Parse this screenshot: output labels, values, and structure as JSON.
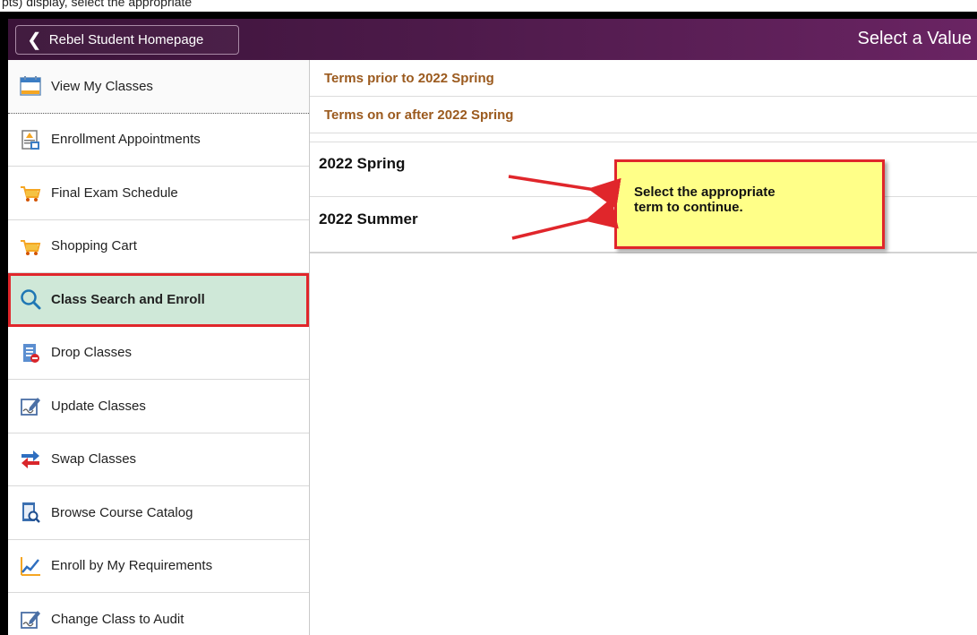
{
  "banner": {
    "text": "pts) display, select the appropriate"
  },
  "header": {
    "back_label": "Rebel Student Homepage",
    "title": "Select a Value"
  },
  "sidebar": {
    "items": [
      {
        "label": "View My Classes",
        "icon": "calendar-icon"
      },
      {
        "label": "Enrollment Appointments",
        "icon": "appointment-icon"
      },
      {
        "label": "Final Exam Schedule",
        "icon": "cart-icon"
      },
      {
        "label": "Shopping Cart",
        "icon": "cart-icon"
      },
      {
        "label": "Class Search and Enroll",
        "icon": "search-icon",
        "active": true
      },
      {
        "label": "Drop Classes",
        "icon": "drop-icon"
      },
      {
        "label": "Update Classes",
        "icon": "edit-icon"
      },
      {
        "label": "Swap Classes",
        "icon": "swap-icon"
      },
      {
        "label": "Browse Course Catalog",
        "icon": "catalog-icon"
      },
      {
        "label": "Enroll by My Requirements",
        "icon": "chart-icon"
      },
      {
        "label": "Change Class to Audit",
        "icon": "edit-icon"
      }
    ]
  },
  "content": {
    "groups": [
      "Terms prior to 2022 Spring",
      "Terms on or after 2022 Spring"
    ],
    "terms": [
      "2022 Spring",
      "2022 Summer"
    ]
  },
  "callout": {
    "line1": "Select the appropriate",
    "line2": "term to continue."
  },
  "colors": {
    "header": "#4d1a4a",
    "group_text": "#9b5a1e",
    "active_bg": "#cfe8d8",
    "highlight": "#e0262b",
    "callout_bg": "#ffff88"
  }
}
